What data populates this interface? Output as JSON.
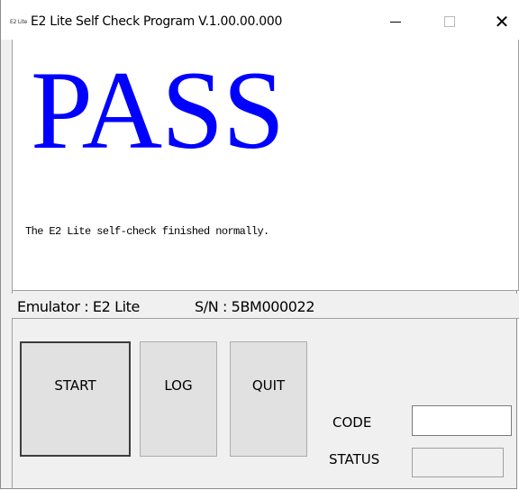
{
  "window": {
    "icon_text": "E2 Lite",
    "title": "E2 Lite Self Check Program V.1.00.00.000",
    "controls": {
      "minimize": "minimize",
      "maximize": "maximize",
      "close": "✕"
    }
  },
  "result": {
    "headline": "PASS",
    "headline_color": "#0000ff",
    "message": "The E2 Lite self-check finished normally."
  },
  "info": {
    "emulator": "Emulator : E2 Lite",
    "serial": "S/N : 5BM000022"
  },
  "buttons": {
    "start": "START",
    "log": "LOG",
    "quit": "QUIT"
  },
  "fields": {
    "code_label": "CODE",
    "code_value": "",
    "status_label": "STATUS",
    "status_value": ""
  }
}
